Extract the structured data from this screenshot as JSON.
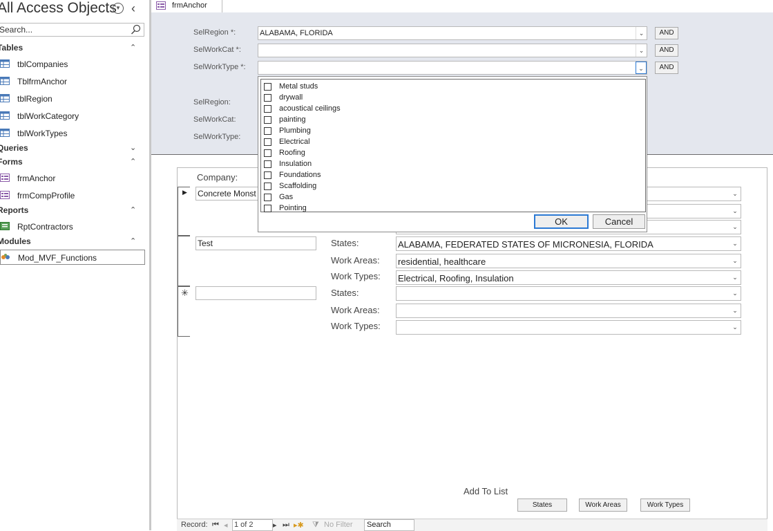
{
  "nav": {
    "title": "All Access Objects",
    "search_placeholder": "Search...",
    "groups": {
      "tables": "Tables",
      "queries": "Queries",
      "forms": "Forms",
      "reports": "Reports",
      "modules": "Modules"
    },
    "tables": [
      "tblCompanies",
      "TblfrmAnchor",
      "tblRegion",
      "tblWorkCategory",
      "tblWorkTypes"
    ],
    "forms": [
      "frmAnchor",
      "frmCompProfile"
    ],
    "reports": [
      "RptContractors"
    ],
    "modules": [
      "Mod_MVF_Functions"
    ]
  },
  "form_tab": "frmAnchor",
  "header": {
    "sel_region_label": "SelRegion *:",
    "sel_region_value": "ALABAMA, FLORIDA",
    "sel_workcat_label": "SelWorkCat *:",
    "sel_workcat_value": "",
    "sel_worktype_label": "SelWorkType *:",
    "sel_worktype_value": "",
    "and_label": "AND",
    "selregion2_label": "SelRegion:",
    "selworkcat2_label": "SelWorkCat:",
    "selworktype2_label": "SelWorkType:"
  },
  "dropdown": {
    "options": [
      "Metal studs",
      "drywall",
      "acoustical ceilings",
      "painting",
      "Plumbing",
      "Electrical",
      "Roofing",
      "Insulation",
      "Foundations",
      "Scaffolding",
      "Gas",
      "Pointing"
    ],
    "ok": "OK",
    "cancel": "Cancel"
  },
  "detail": {
    "company_label": "Company:",
    "states_label": "States:",
    "work_areas_label": "Work Areas:",
    "work_types_label": "Work Types:",
    "records": [
      {
        "company": "Concrete Monst",
        "states": "",
        "work_areas": "",
        "work_types": ""
      },
      {
        "company": "Test",
        "states": "ALABAMA, FEDERATED STATES OF MICRONESIA, FLORIDA",
        "work_areas": "residential, healthcare",
        "work_types": "Electrical, Roofing, Insulation"
      },
      {
        "company": "",
        "states": "",
        "work_areas": "",
        "work_types": ""
      }
    ],
    "add_to_list": "Add To List",
    "btn_states": "States",
    "btn_work_areas": "Work Areas",
    "btn_work_types": "Work Types"
  },
  "recnav": {
    "record_label": "Record:",
    "position": "1 of 2",
    "no_filter": "No Filter",
    "search": "Search"
  }
}
